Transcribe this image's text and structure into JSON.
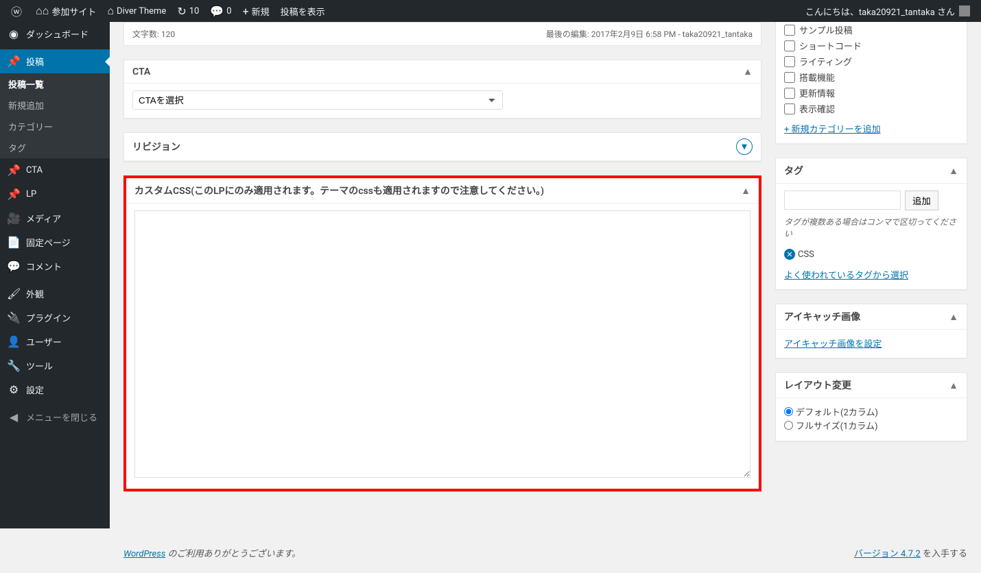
{
  "adminbar": {
    "mysites": "参加サイト",
    "site": "Diver Theme",
    "updates": "10",
    "comments": "0",
    "new": "新規",
    "view_post": "投稿を表示",
    "greeting": "こんにちは、taka20921_tantaka さん"
  },
  "menu": {
    "dashboard": "ダッシュボード",
    "posts": "投稿",
    "posts_sub": {
      "all": "投稿一覧",
      "new": "新規追加",
      "cat": "カテゴリー",
      "tag": "タグ"
    },
    "cta": "CTA",
    "lp": "LP",
    "media": "メディア",
    "pages": "固定ページ",
    "comments": "コメント",
    "appearance": "外観",
    "plugins": "プラグイン",
    "users": "ユーザー",
    "tools": "ツール",
    "settings": "設定",
    "collapse": "メニューを閉じる"
  },
  "wordcount": {
    "label_prefix": "文字数: ",
    "count": "120",
    "last_edit": "最後の編集: 2017年2月9日 6:58 PM - taka20921_tantaka"
  },
  "cta_box": {
    "title": "CTA",
    "placeholder": "CTAを選択"
  },
  "revisions": {
    "title": "リビジョン"
  },
  "customcss": {
    "title": "カスタムCSS(このLPにのみ適用されます。テーマのcssも適用されますので注意してください。)"
  },
  "categories": {
    "items": [
      "サンプル投稿",
      "ショートコード",
      "ライティング",
      "搭載機能",
      "更新情報",
      "表示確認"
    ],
    "add_link": "+ 新規カテゴリーを追加"
  },
  "tags": {
    "title": "タグ",
    "add_btn": "追加",
    "help": "タグが複数ある場合はコンマで区切ってください",
    "existing": "CSS",
    "popular_link": "よく使われているタグから選択"
  },
  "featured": {
    "title": "アイキャッチ画像",
    "link": "アイキャッチ画像を設定"
  },
  "layout": {
    "title": "レイアウト変更",
    "opt1": "デフォルト(2カラム)",
    "opt2": "フルサイズ(1カラム)"
  },
  "footer": {
    "wp_link": "WordPress",
    "thanks": " のご利用ありがとうございます。",
    "version_prefix": "バージョン 4.7.2",
    "get": " を入手する"
  }
}
